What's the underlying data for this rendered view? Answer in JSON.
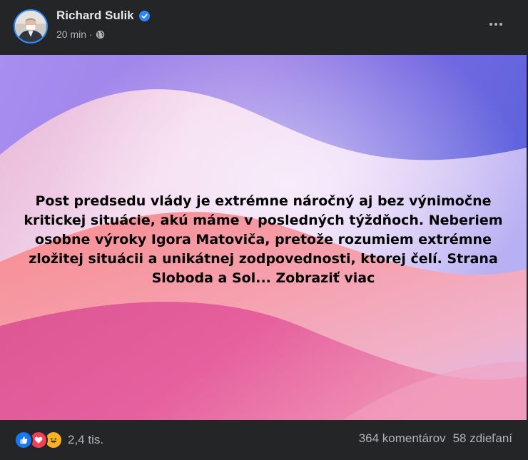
{
  "post": {
    "author": "Richard Sulik",
    "time": "20 min",
    "separator": "·",
    "privacy_icon": "globe-icon",
    "verified_icon": "verified-badge-icon",
    "more_icon": "more-options-icon",
    "text": "Post predsedu vlády je extrémne náročný aj bez výnimočne kritickej situácie, akú máme v posledných týždňoch. Neberiem osobne výroky Igora Matoviča, pretože rozumiem extrémne zložitej situácii a unikátnej zodpovednosti, ktorej čelí. Strana Sloboda a Sol...",
    "see_more": "Zobraziť viac"
  },
  "footer": {
    "reactions": [
      "like-reaction-icon",
      "love-reaction-icon",
      "haha-reaction-icon"
    ],
    "reaction_count": "2,4 tis.",
    "comments": "364 komentárov",
    "shares": "58 zdieľaní"
  },
  "colors": {
    "background": "#242526",
    "accent": "#2d88ff",
    "text_primary": "#e4e6eb",
    "text_secondary": "#b0b3b8"
  }
}
